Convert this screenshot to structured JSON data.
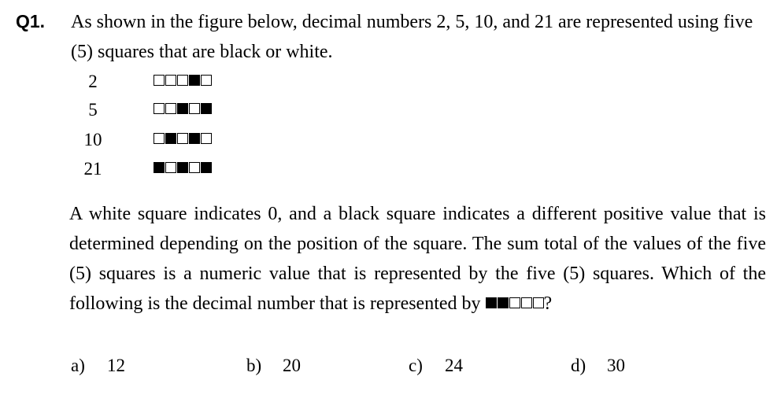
{
  "question": {
    "number": "Q1.",
    "intro": "As shown in the figure below, decimal numbers 2, 5, 10, and 21 are represented using five (5) squares that are black or white.",
    "rows": [
      {
        "decimal": "2",
        "squares": [
          0,
          0,
          0,
          1,
          0
        ]
      },
      {
        "decimal": "5",
        "squares": [
          0,
          0,
          1,
          0,
          1
        ]
      },
      {
        "decimal": "10",
        "squares": [
          0,
          1,
          0,
          1,
          0
        ]
      },
      {
        "decimal": "21",
        "squares": [
          1,
          0,
          1,
          0,
          1
        ]
      }
    ],
    "body": "A white square indicates 0, and a black square indicates a different positive value that is determined depending on the position of the square. The sum total of the values of the five (5) squares is a numeric value that is represented by the five (5) squares. Which of the following is the decimal number that is represented by",
    "query_squares": [
      1,
      1,
      0,
      0,
      0
    ],
    "body_end": "?",
    "choices": [
      {
        "letter": "a)",
        "value": "12"
      },
      {
        "letter": "b)",
        "value": "20"
      },
      {
        "letter": "c)",
        "value": "24"
      },
      {
        "letter": "d)",
        "value": "30"
      }
    ]
  }
}
